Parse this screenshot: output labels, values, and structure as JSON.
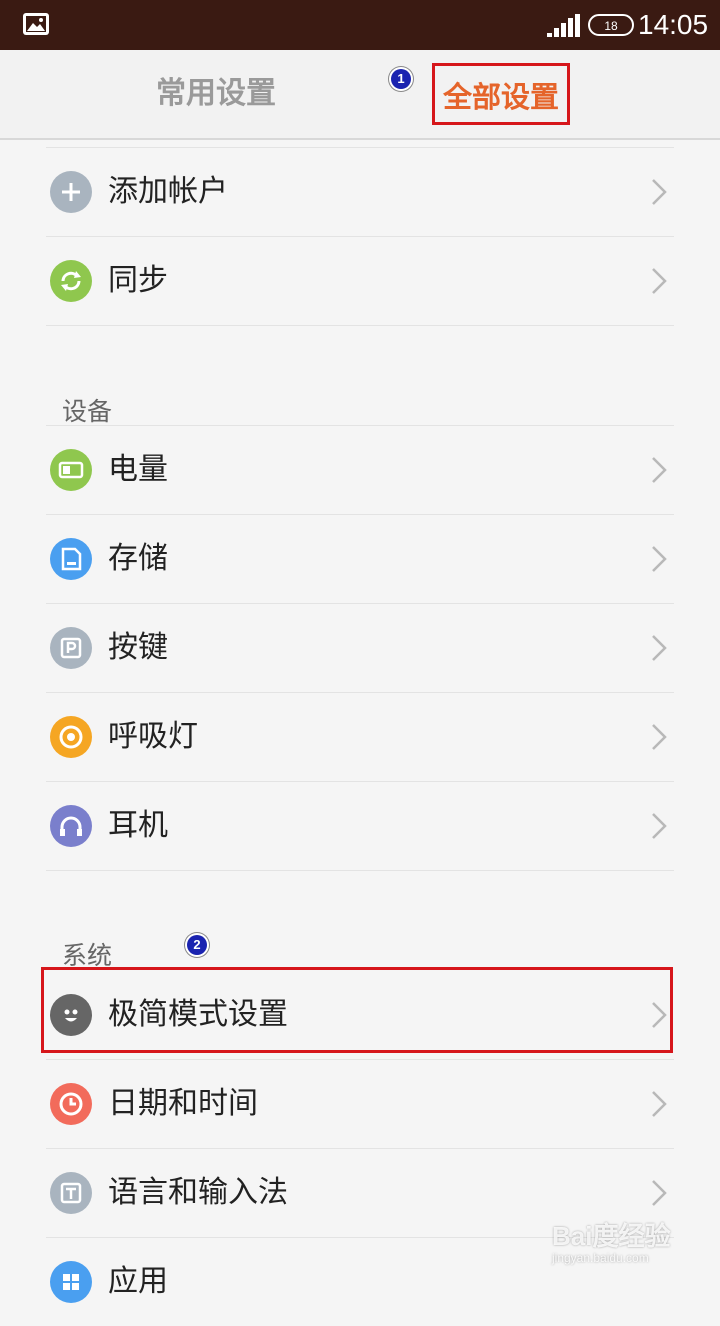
{
  "status_bar": {
    "time": "14:05",
    "battery_label": "18",
    "icons": [
      "image-notification-icon",
      "signal-icon",
      "battery-icon"
    ]
  },
  "tabs": [
    {
      "label": "常用设置",
      "selected": false
    },
    {
      "label": "全部设置",
      "selected": true
    }
  ],
  "annotations": {
    "badge_1": "1",
    "badge_2": "2"
  },
  "colors": {
    "accent": "#e5642a",
    "highlight_border": "#d6161b",
    "status_bar_bg": "#3a1a12"
  },
  "accounts_items": [
    {
      "label": "添加帐户",
      "icon": "add-icon",
      "color": "#a9b4bf"
    },
    {
      "label": "同步",
      "icon": "sync-icon",
      "color": "#8fc74e"
    }
  ],
  "sections": {
    "device": {
      "header": "设备",
      "items": [
        {
          "label": "电量",
          "icon": "battery-icon",
          "color": "#8fc74e"
        },
        {
          "label": "存储",
          "icon": "storage-icon",
          "color": "#4a9ff0"
        },
        {
          "label": "按键",
          "icon": "button-icon",
          "color": "#a9b4bf"
        },
        {
          "label": "呼吸灯",
          "icon": "breathing-light-icon",
          "color": "#f5a623"
        },
        {
          "label": "耳机",
          "icon": "headphones-icon",
          "color": "#7a7fcc"
        }
      ]
    },
    "system": {
      "header": "系统",
      "items": [
        {
          "label": "极简模式设置",
          "icon": "smiley-icon",
          "color": "#666666"
        },
        {
          "label": "日期和时间",
          "icon": "clock-icon",
          "color": "#f26b5b"
        },
        {
          "label": "语言和输入法",
          "icon": "language-icon",
          "color": "#a9b4bf"
        },
        {
          "label": "应用",
          "icon": "apps-icon",
          "color": "#4a9ff0"
        }
      ]
    }
  },
  "watermark": {
    "main": "Bai度经验",
    "sub": "jingyan.baidu.com"
  }
}
